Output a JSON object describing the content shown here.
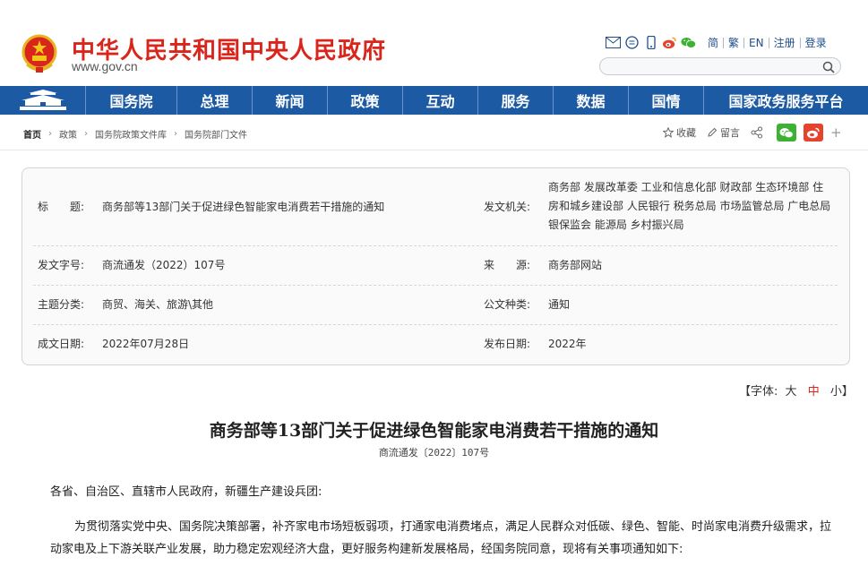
{
  "header": {
    "site_title": "中华人民共和国中央人民政府",
    "site_url": "www.gov.cn",
    "icons": [
      "mail-icon",
      "chat-icon",
      "mobile-icon",
      "weibo-icon",
      "wechat-icon"
    ],
    "links": [
      "简",
      "繁",
      "EN",
      "注册",
      "登录"
    ],
    "search_placeholder": ""
  },
  "nav": {
    "items": [
      "国务院",
      "总理",
      "新闻",
      "政策",
      "互动",
      "服务",
      "数据",
      "国情",
      "国家政务服务平台"
    ]
  },
  "breadcrumb": [
    "首页",
    "政策",
    "国务院政策文件库",
    "国务院部门文件"
  ],
  "actions": {
    "favorite": "收藏",
    "comment": "留言",
    "share_icon": "share-icon",
    "wechat_color": "#3eb135",
    "weibo_color": "#e6432f",
    "more": "+"
  },
  "info": {
    "title_label": "标　　题:",
    "title_value": "商务部等13部门关于促进绿色智能家电消费若干措施的通知",
    "issuer_label": "发文机关:",
    "issuer_value": "商务部 发展改革委 工业和信息化部 财政部 生态环境部 住房和城乡建设部 人民银行 税务总局 市场监管总局 广电总局 银保监会 能源局 乡村振兴局",
    "docno_label": "发文字号:",
    "docno_value": "商流通发（2022）107号",
    "source_label": "来　　源:",
    "source_value": "商务部网站",
    "subject_label": "主题分类:",
    "subject_value": "商贸、海关、旅游\\其他",
    "type_label": "公文种类:",
    "type_value": "通知",
    "written_label": "成文日期:",
    "written_value": "2022年07月28日",
    "published_label": "发布日期:",
    "published_value": "2022年"
  },
  "fontsize": {
    "prefix": "【字体:",
    "large": "大",
    "medium": "中",
    "small": "小",
    "suffix": "】"
  },
  "document": {
    "title": "商务部等13部门关于促进绿色智能家电消费若干措施的通知",
    "number": "商流通发〔2022〕107号",
    "addressee": "各省、自治区、直辖市人民政府，新疆生产建设兵团:",
    "paragraph": "为贯彻落实党中央、国务院决策部署，补齐家电市场短板弱项，打通家电消费堵点，满足人民群众对低碳、绿色、智能、时尚家电消费升级需求，拉动家电及上下游关联产业发展，助力稳定宏观经济大盘，更好服务构建新发展格局，经国务院同意，现将有关事项通知如下:"
  },
  "colors": {
    "brand_red": "#d9261c",
    "nav_blue": "#1c5aa4",
    "link_blue": "#1e4e8c"
  }
}
